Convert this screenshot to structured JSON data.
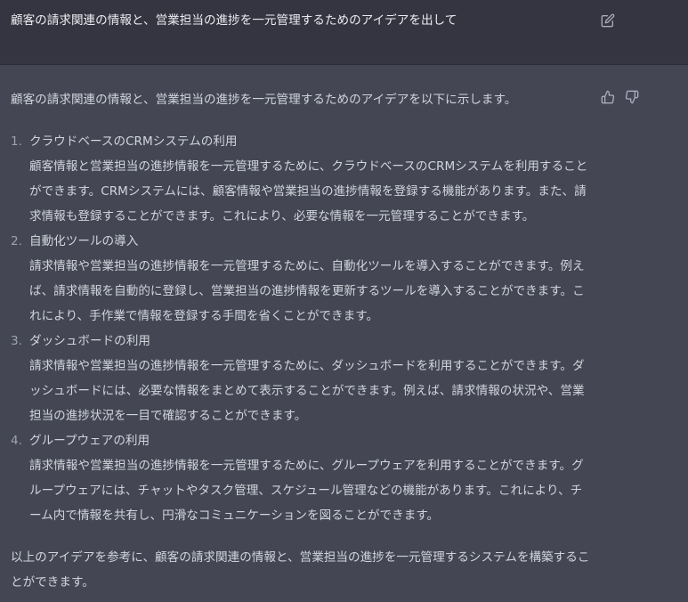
{
  "user_message": {
    "text": "顧客の請求関連の情報と、営業担当の進捗を一元管理するためのアイデアを出して",
    "edit_icon": "edit-icon"
  },
  "assistant_message": {
    "intro": "顧客の請求関連の情報と、営業担当の進捗を一元管理するためのアイデアを以下に示します。",
    "items": [
      {
        "number": "1.",
        "title": "クラウドベースのCRMシステムの利用",
        "body": "顧客情報と営業担当の進捗情報を一元管理するために、クラウドベースのCRMシステムを利用することができます。CRMシステムには、顧客情報や営業担当の進捗情報を登録する機能があります。また、請求情報も登録することができます。これにより、必要な情報を一元管理することができます。"
      },
      {
        "number": "2.",
        "title": "自動化ツールの導入",
        "body": "請求情報や営業担当の進捗情報を一元管理するために、自動化ツールを導入することができます。例えば、請求情報を自動的に登録し、営業担当の進捗情報を更新するツールを導入することができます。これにより、手作業で情報を登録する手間を省くことができます。"
      },
      {
        "number": "3.",
        "title": "ダッシュボードの利用",
        "body": "請求情報や営業担当の進捗情報を一元管理するために、ダッシュボードを利用することができます。ダッシュボードには、必要な情報をまとめて表示することができます。例えば、請求情報の状況や、営業担当の進捗状況を一目で確認することができます。"
      },
      {
        "number": "4.",
        "title": "グループウェアの利用",
        "body": "請求情報や営業担当の進捗情報を一元管理するために、グループウェアを利用することができます。グループウェアには、チャットやタスク管理、スケジュール管理などの機能があります。これにより、チーム内で情報を共有し、円滑なコミュニケーションを図ることができます。"
      }
    ],
    "conclusion": "以上のアイデアを参考に、顧客の請求関連の情報と、営業担当の進捗を一元管理するシステムを構築することができます。",
    "feedback_icons": [
      "thumbs-up-icon",
      "thumbs-down-icon"
    ]
  },
  "colors": {
    "user_bg": "#343541",
    "assistant_bg": "#444654",
    "user_text": "#ececf1",
    "assistant_text": "#d1d5db",
    "icon": "#acacbe"
  }
}
